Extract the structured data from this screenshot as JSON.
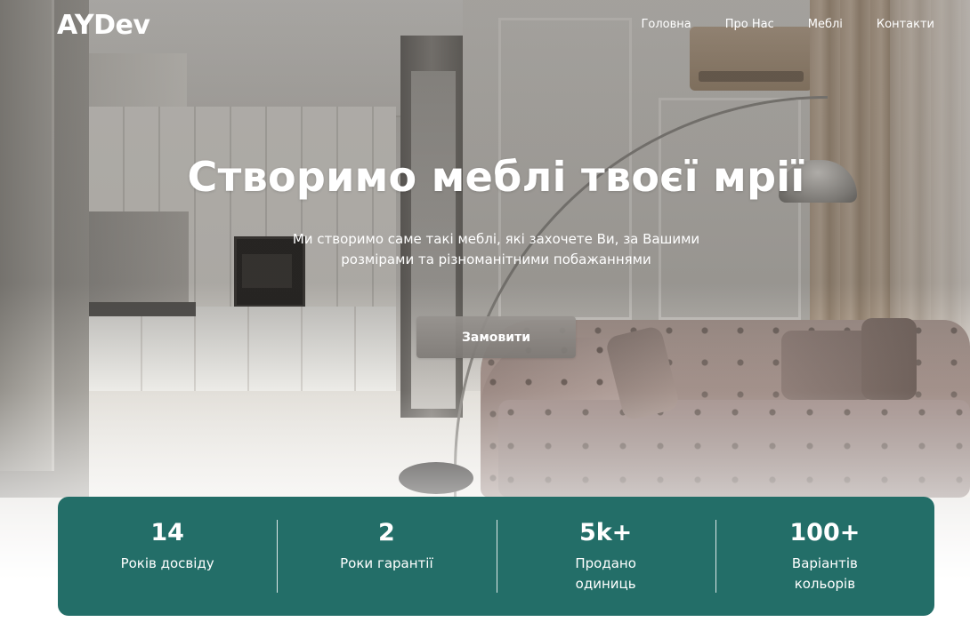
{
  "header": {
    "logo": "AYDev",
    "nav": [
      {
        "label": "Головна"
      },
      {
        "label": "Про Нас"
      },
      {
        "label": "Меблі"
      },
      {
        "label": "Контакти"
      }
    ]
  },
  "hero": {
    "title": "Створимо меблі твоєї мрії",
    "subtitle": "Ми створимо саме такі меблі, які захочете Ви, за Вашими розмірами та різноманітними побажаннями",
    "cta_label": "Замовити"
  },
  "stats": [
    {
      "value": "14",
      "label": "Років досвіду"
    },
    {
      "value": "2",
      "label": "Роки гарантії"
    },
    {
      "value": "5k+",
      "label": "Продано одиниць"
    },
    {
      "value": "100+",
      "label": "Варіантів кольорів"
    }
  ],
  "colors": {
    "accent": "#236e68",
    "text_on_dark": "#ffffff"
  }
}
